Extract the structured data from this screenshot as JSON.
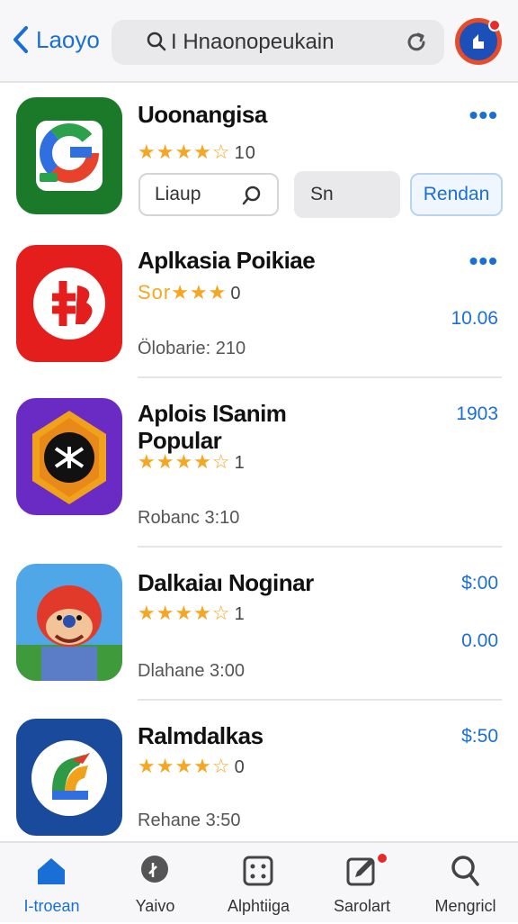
{
  "header": {
    "back_label": "Laoyo",
    "search_text": "I Hnaonopeukain"
  },
  "apps": [
    {
      "title": "Uoonangisa",
      "stars": "★★★★☆",
      "rating_count": "10",
      "button_search_label": "Liaup",
      "button_mid_label": "Sn",
      "button_action_label": "Rendan"
    },
    {
      "title": "Aplkasia Poikiae",
      "stars": "Sor★★★",
      "rating_count": "0",
      "price": "10.06",
      "sub": "Ölobarie: 210"
    },
    {
      "title": "Aplois ISanim",
      "title2": "Popular",
      "stars": "★★★★☆",
      "rating_count": "1",
      "price": "1903",
      "sub": "Robanc 3:10"
    },
    {
      "title": "Dalkaiaı Noginar",
      "stars": "★★★★☆",
      "rating_count": "1",
      "price": "$:00",
      "price2": "0.00",
      "sub": "Dlahane 3:00"
    },
    {
      "title": "Ralmdalkas",
      "stars": "★★★★☆",
      "rating_count": "0",
      "price": "$:50",
      "sub": "Rehane 3:50"
    }
  ],
  "tabs": [
    {
      "label": "I-troean",
      "icon": "home-icon"
    },
    {
      "label": "Yaivo",
      "icon": "map-pin-icon"
    },
    {
      "label": "Alphtiiga",
      "icon": "grid-icon"
    },
    {
      "label": "Sarolart",
      "icon": "edit-icon"
    },
    {
      "label": "Mengricl",
      "icon": "search-icon"
    }
  ],
  "colors": {
    "accent": "#1a6fd6",
    "star": "#f5a623",
    "badge": "#e62b2b"
  }
}
